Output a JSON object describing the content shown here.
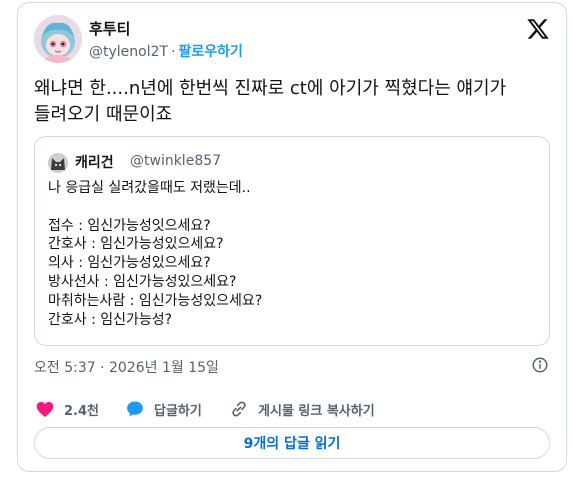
{
  "author": {
    "display_name": "후투티",
    "handle": "@tylenol2T",
    "separator": "·",
    "follow_label": "팔로우하기"
  },
  "tweet": {
    "text": "왜냐면 한....n년에 한번씩 진짜로 ct에 아기가 찍혔다는 얘기가\n들려오기 때문이죠"
  },
  "quoted": {
    "display_name": "캐리건",
    "handle": "@twinkle857",
    "text": "나 응급실 실려갔을때도 저랬는데..\n\n접수 : 임신가능성잇으세요?\n간호사 : 임신가능성있으세요?\n의사 : 임신가능성있으세요?\n방사선사 : 임신가능성있으세요?\n마취하는사람 : 임신가능성있으세요?\n간호사 : 임신가능성?"
  },
  "meta": {
    "timestamp": "오전 5:37 · 2026년 1월 15일"
  },
  "actions": {
    "like_count": "2.4천",
    "reply_label": "답글하기",
    "copy_link_label": "게시물 링크 복사하기"
  },
  "footer": {
    "read_replies_label": "9개의 답글 읽기"
  },
  "colors": {
    "like": "#f91880",
    "reply": "#1d9bf0",
    "link": "#1d9bf0",
    "muted": "#536471",
    "border": "#cfd9de"
  }
}
